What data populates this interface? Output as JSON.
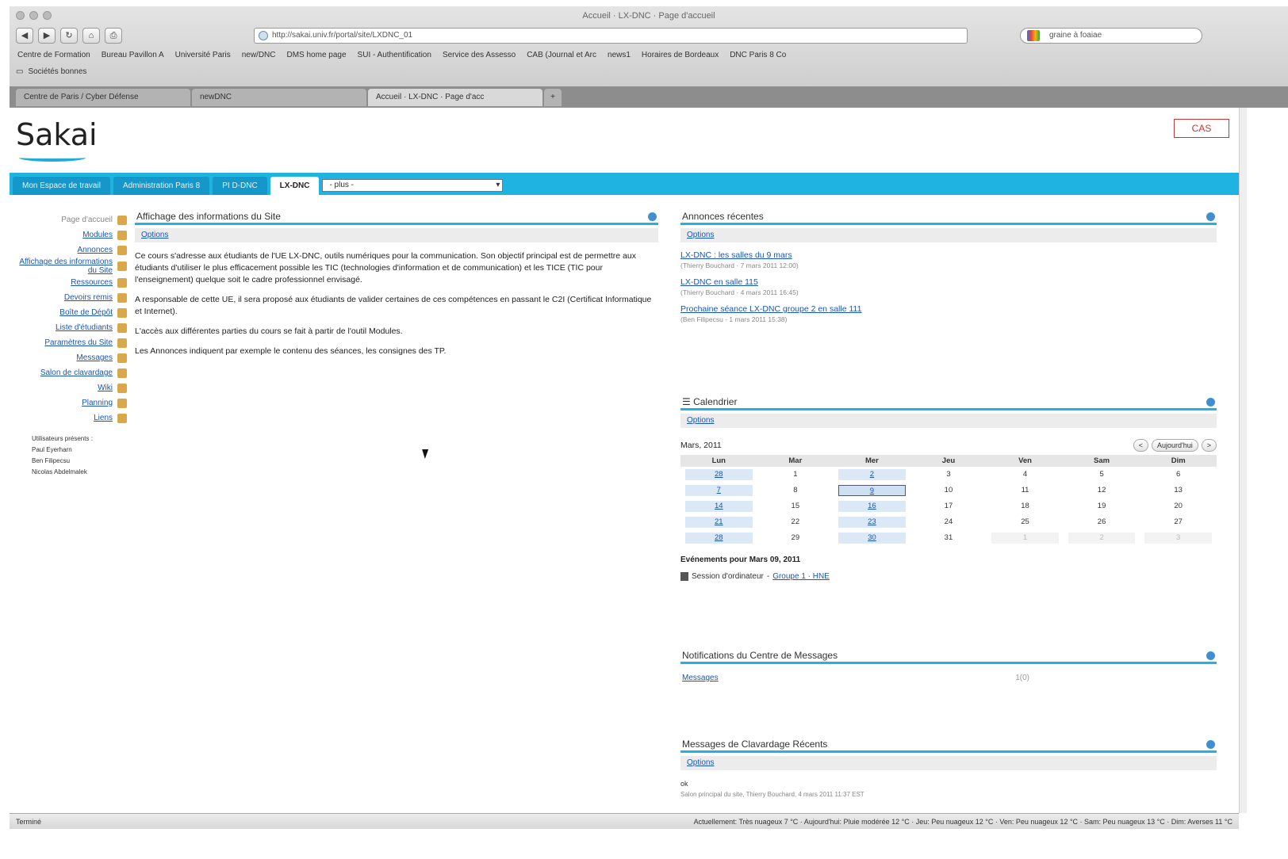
{
  "browser": {
    "window_title": "Accueil · LX-DNC · Page d'accueil",
    "url": "http://sakai.univ.fr/portal/site/LXDNC_01",
    "search_placeholder": "graine à foaiae",
    "bookmarks": [
      "Centre de Formation",
      "Bureau Pavillon A",
      "Université Paris",
      "new/DNC",
      "DMS home page",
      "SUI - Authentification",
      "Service des Assesso",
      "CAB (Journal et Arc",
      "news1",
      "Horaires de Bordeaux",
      "DNC Paris 8 Co"
    ],
    "bookmarks_row2": "Sociétés bonnes",
    "tabs": [
      {
        "label": "Centre de Paris / Cyber Défense"
      },
      {
        "label": "newDNC"
      },
      {
        "label": "Accueil · LX-DNC · Page d'acc"
      }
    ],
    "status_left": "Terminé",
    "status_right": "Actuellement: Très nuageux 7 °C · Aujourd'hui: Pluie modérée 12 °C · Jeu: Peu nuageux 12 °C · Ven: Peu nuageux 12 °C · Sam: Peu nuageux 13 °C · Dim: Averses 11 °C"
  },
  "header": {
    "logo": "Sakai",
    "cas_label": "CAS"
  },
  "sitenav": {
    "tabs": [
      "Mon Espace de travail",
      "Administration Paris 8",
      "PI D-DNC",
      "LX-DNC"
    ],
    "select_value": "- plus -"
  },
  "toolmenu": {
    "items": [
      {
        "label": "Page d'accueil",
        "current": true
      },
      {
        "label": "Modules"
      },
      {
        "label": "Annonces"
      },
      {
        "label": "Affichage des informations du Site"
      },
      {
        "label": "Ressources"
      },
      {
        "label": "Devoirs remis"
      },
      {
        "label": "Boîte de Dépôt"
      },
      {
        "label": "Liste d'étudiants"
      },
      {
        "label": "Paramètres du Site"
      },
      {
        "label": "Messages"
      },
      {
        "label": "Salon de clavardage"
      },
      {
        "label": "Wiki"
      },
      {
        "label": "Planning"
      },
      {
        "label": "Liens"
      }
    ],
    "presence_title": "Utilisateurs présents :",
    "presence_users": [
      "Paul Eyerharn",
      "Ben Filipecsu",
      "Nicolas Abdelmalek"
    ]
  },
  "siteinfo": {
    "title": "Affichage des informations du Site",
    "toolbar_link": "Options",
    "paragraphs": [
      "Ce cours s'adresse aux étudiants de l'UE LX-DNC, outils numériques pour la communication. Son objectif principal est de permettre aux étudiants d'utiliser le plus efficacement possible les TIC (technologies d'information et de communication) et les TICE (TIC pour l'enseignement) quelque soit le cadre professionnel envisagé.",
      "A responsable de cette UE, il sera proposé aux étudiants de valider certaines de ces compétences en passant le C2I (Certificat Informatique et Internet).",
      "L'accès aux différentes parties du cours se fait à partir de l'outil Modules.",
      "Les Annonces indiquent par exemple le contenu des séances, les consignes des TP."
    ]
  },
  "announcements": {
    "title": "Annonces récentes",
    "toolbar_link": "Options",
    "items": [
      {
        "title": "LX-DNC : les salles du 9 mars",
        "meta": "(Thierry Bouchard · 7 mars 2011 12:00)"
      },
      {
        "title": "LX-DNC en salle 115",
        "meta": "(Thierry Bouchard · 4 mars 2011 16:45)"
      },
      {
        "title": "Prochaine séance LX-DNC groupe 2 en salle 111",
        "meta": "(Ben Filipecsu · 1 mars 2011 15:38)"
      }
    ]
  },
  "calendar": {
    "title": "Calendrier",
    "toolbar_link": "Options",
    "month_label": "Mars, 2011",
    "prev": "<",
    "today": "Aujourd'hui",
    "next": ">",
    "weekdays": [
      "Lun",
      "Mar",
      "Mer",
      "Jeu",
      "Ven",
      "Sam",
      "Dim"
    ],
    "weeks": [
      [
        "28",
        "1",
        "2",
        "3",
        "4",
        "5",
        "6"
      ],
      [
        "7",
        "8",
        "9",
        "10",
        "11",
        "12",
        "13"
      ],
      [
        "14",
        "15",
        "16",
        "17",
        "18",
        "19",
        "20"
      ],
      [
        "21",
        "22",
        "23",
        "24",
        "25",
        "26",
        "27"
      ],
      [
        "28",
        "29",
        "30",
        "31",
        "1",
        "2",
        "3"
      ]
    ],
    "events_title": "Evénements pour Mars 09, 2011",
    "event_label": "Session d'ordinateur",
    "event_link": "Groupe 1 · HNE"
  },
  "messages": {
    "title": "Notifications du Centre de Messages",
    "link": "Messages",
    "count": "1(0)"
  },
  "chat": {
    "title": "Messages de Clavardage Récents",
    "toolbar_link": "Options",
    "message": "ok",
    "meta": "Salon principal du site, Thierry Bouchard, 4 mars 2011 11:37 EST"
  },
  "colors": {
    "accent": "#1fb3e2",
    "link": "#1a55b5"
  }
}
